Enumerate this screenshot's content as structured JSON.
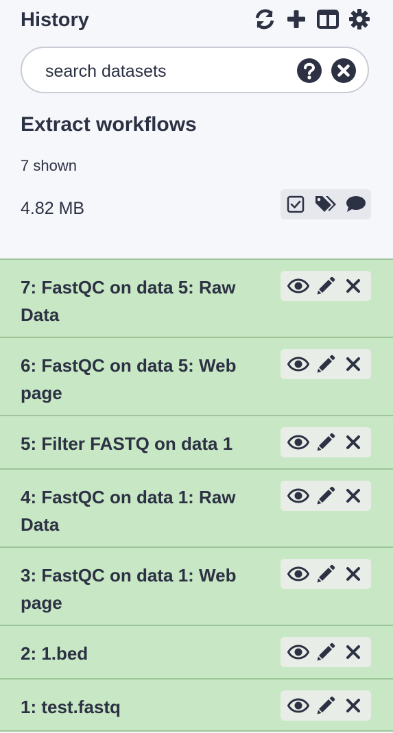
{
  "header": {
    "title": "History",
    "icons": [
      "refresh-icon",
      "plus-icon",
      "columns-icon",
      "gear-icon"
    ]
  },
  "search": {
    "placeholder": "search datasets",
    "value": "",
    "help_icon": "question-circle-icon",
    "clear_icon": "times-circle-icon"
  },
  "history": {
    "name": "Extract workflows",
    "shown": "7 shown",
    "size": "4.82 MB",
    "tool_icons": [
      "check-square-icon",
      "tags-icon",
      "comment-icon"
    ]
  },
  "datasets": [
    {
      "title": "7: FastQC on data 5: Raw Data"
    },
    {
      "title": "6: FastQC on data 5: Web page"
    },
    {
      "title": "5: Filter FASTQ on data 1"
    },
    {
      "title": "4: FastQC on data 1: Raw Data"
    },
    {
      "title": "3: FastQC on data 1: Web page"
    },
    {
      "title": "2: 1.bed"
    },
    {
      "title": "1: test.fastq"
    }
  ],
  "item_actions": [
    "eye-icon",
    "pencil-icon",
    "times-icon"
  ],
  "colors": {
    "ok_state": "#c8e8c5",
    "ok_border": "#9ec49a",
    "text": "#2c3143"
  }
}
